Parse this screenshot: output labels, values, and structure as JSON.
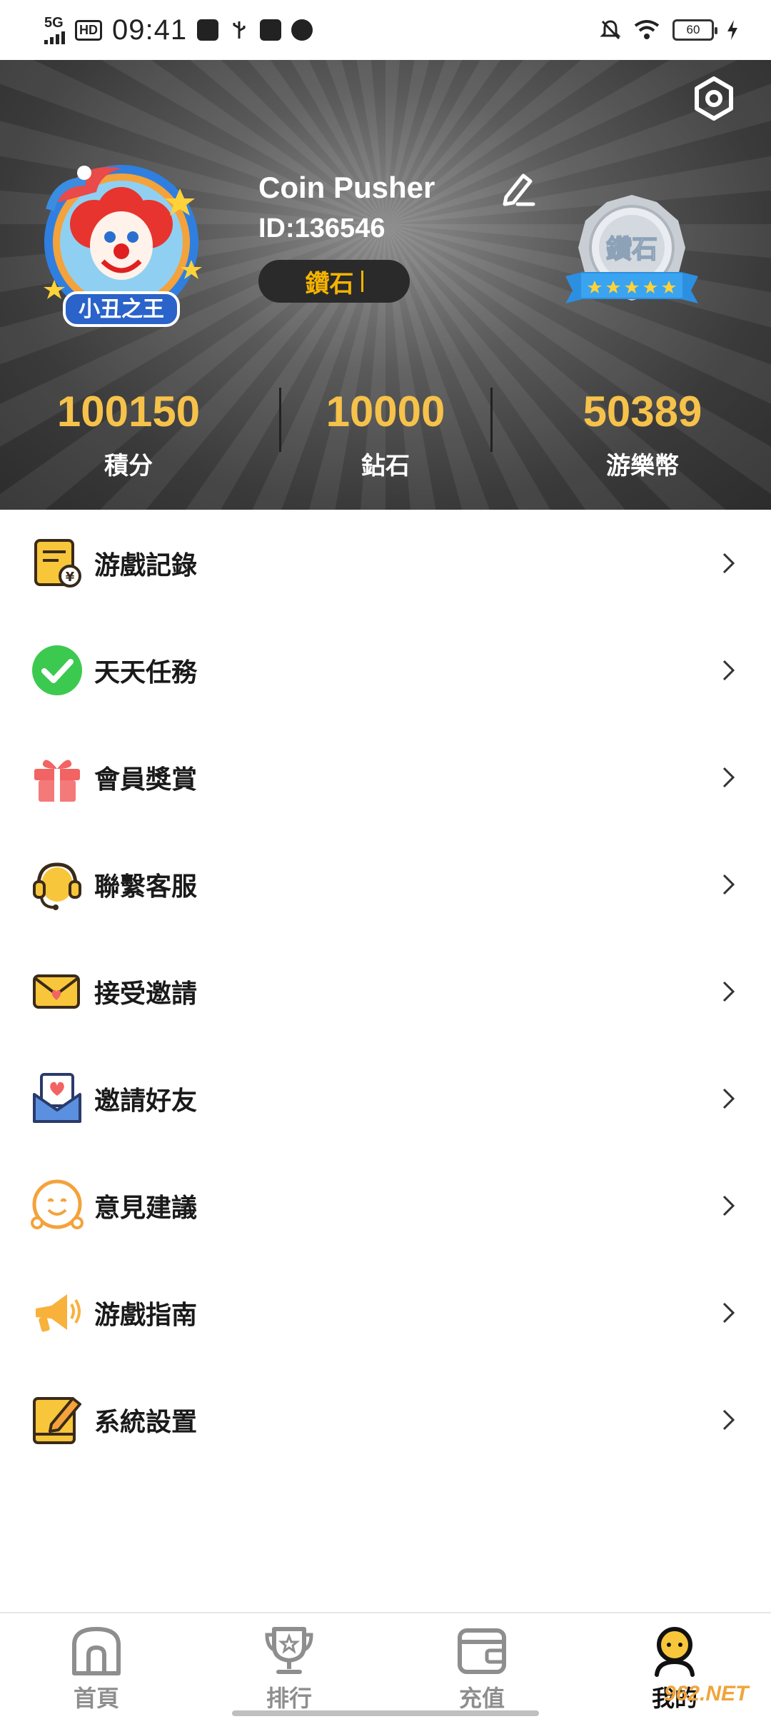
{
  "status_bar": {
    "network": "5G",
    "hd": "HD",
    "time": "09:41",
    "battery": "60"
  },
  "profile": {
    "name": "Coin Pusher",
    "id_text": "ID:136546",
    "level": "鑽石",
    "avatar_title": "小丑之王",
    "badge_text": "鑽石"
  },
  "stats": [
    {
      "value": "100150",
      "label": "積分"
    },
    {
      "value": "10000",
      "label": "鉆石"
    },
    {
      "value": "50389",
      "label": "游樂幣"
    }
  ],
  "menu": [
    {
      "label": "游戲記錄",
      "icon": "game-record-icon"
    },
    {
      "label": "天天任務",
      "icon": "checkmark-icon"
    },
    {
      "label": "會員獎賞",
      "icon": "gift-icon"
    },
    {
      "label": "聯繫客服",
      "icon": "headset-icon"
    },
    {
      "label": "接受邀請",
      "icon": "envelope-icon"
    },
    {
      "label": "邀請好友",
      "icon": "heart-mail-icon"
    },
    {
      "label": "意見建議",
      "icon": "smiley-icon"
    },
    {
      "label": "游戲指南",
      "icon": "megaphone-icon"
    },
    {
      "label": "系統設置",
      "icon": "notepad-icon"
    }
  ],
  "nav": [
    {
      "label": "首頁",
      "icon": "home-icon"
    },
    {
      "label": "排行",
      "icon": "trophy-icon"
    },
    {
      "label": "充值",
      "icon": "wallet-icon"
    },
    {
      "label": "我的",
      "icon": "profile-icon"
    }
  ],
  "watermark": "962.NET",
  "colors": {
    "accent_gold": "#f6c24a",
    "level_text": "#f5b400",
    "check_green": "#3cc94f",
    "gift_red": "#f26363",
    "icon_yellow": "#f8c63a"
  }
}
